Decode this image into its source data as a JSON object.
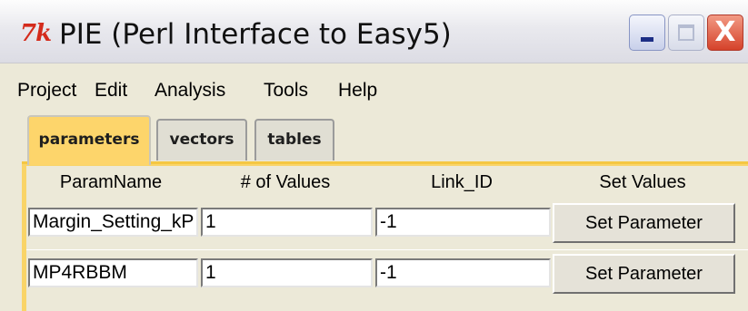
{
  "window": {
    "title": "PIE (Perl Interface to Easy5)",
    "logo_text": "7k",
    "controls": {
      "minimize": "minimize",
      "maximize": "maximize",
      "close": "X"
    }
  },
  "menu": [
    "Project",
    "Edit",
    "Analysis",
    "Tools",
    "Help"
  ],
  "tabs": [
    {
      "label": "parameters",
      "active": true
    },
    {
      "label": "vectors",
      "active": false
    },
    {
      "label": "tables",
      "active": false
    }
  ],
  "table": {
    "headers": [
      "ParamName",
      "# of Values",
      "Link_ID",
      "Set Values"
    ],
    "rows": [
      {
        "param_name": "Margin_Setting_kP",
        "num_values": "1",
        "link_id": "-1",
        "button": "Set Parameter"
      },
      {
        "param_name": "MP4RBBM",
        "num_values": "1",
        "link_id": "-1",
        "button": "Set Parameter"
      }
    ]
  },
  "colors": {
    "active_tab": "#fdd56b",
    "window_bg": "#ece9d8",
    "close_button": "#d5422a"
  }
}
